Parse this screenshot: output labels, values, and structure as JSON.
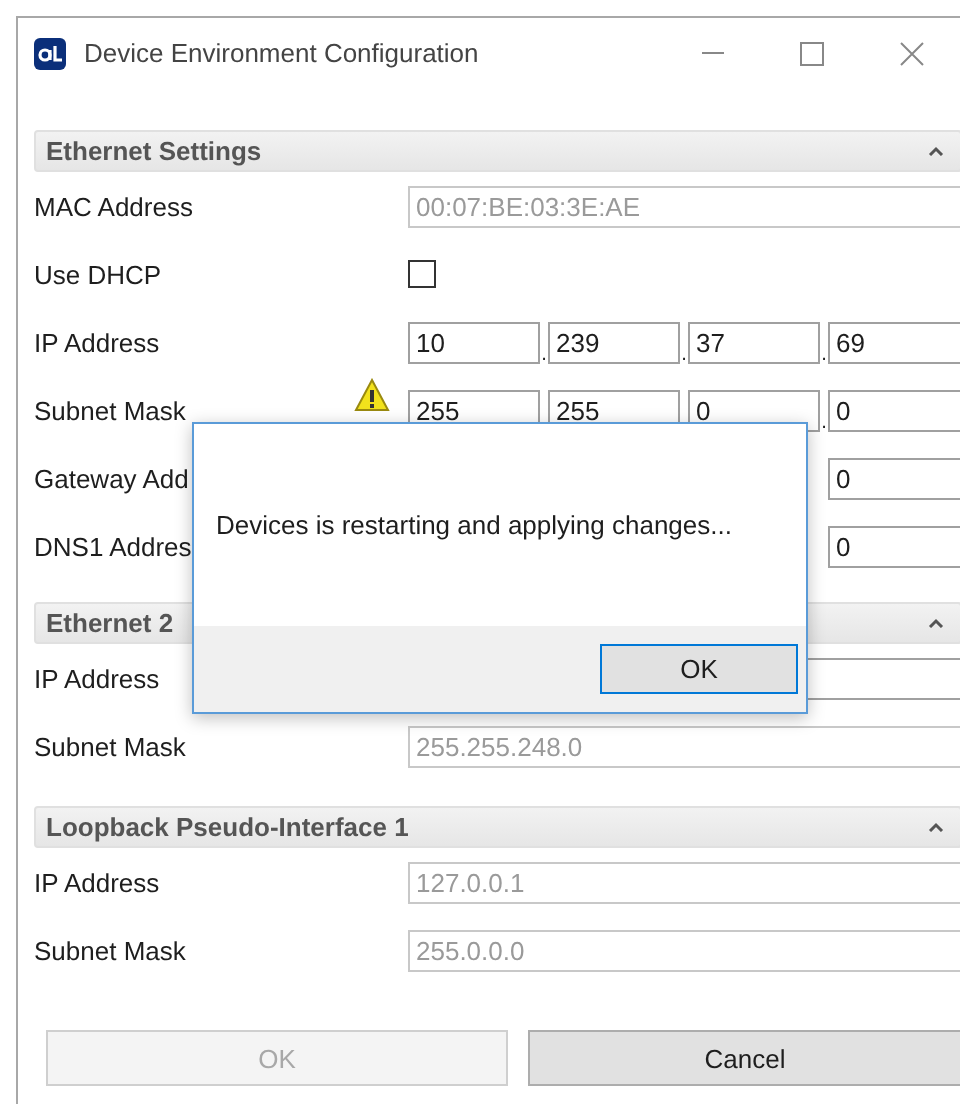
{
  "window": {
    "title": "Device Environment Configuration"
  },
  "octet_separator": ".",
  "sections": [
    {
      "title": "Ethernet Settings",
      "expanded": true,
      "rows": [
        {
          "kind": "text",
          "label": "MAC Address",
          "value": "00:07:BE:03:3E:AE",
          "disabled": true
        },
        {
          "kind": "checkbox",
          "label": "Use DHCP",
          "checked": false
        },
        {
          "kind": "ip",
          "label": "IP Address",
          "octets": [
            "10",
            "239",
            "37",
            "69"
          ]
        },
        {
          "kind": "ip",
          "label": "Subnet Mask",
          "octets": [
            "255",
            "255",
            "0",
            "0"
          ],
          "warning": true
        },
        {
          "kind": "ip",
          "label": "Gateway Add",
          "octets": [
            "0"
          ]
        },
        {
          "kind": "ip",
          "label": "DNS1 Addres",
          "octets": [
            "0"
          ]
        }
      ]
    },
    {
      "title": "Ethernet 2",
      "expanded": true,
      "rows": [
        {
          "kind": "text",
          "label": "IP Address",
          "disabled": false
        },
        {
          "kind": "text",
          "label": "Subnet Mask",
          "value": "255.255.248.0",
          "disabled": true
        }
      ]
    },
    {
      "title": "Loopback Pseudo-Interface 1",
      "expanded": true,
      "rows": [
        {
          "kind": "text",
          "label": "IP Address",
          "value": "127.0.0.1",
          "disabled": true
        },
        {
          "kind": "text",
          "label": "Subnet Mask",
          "value": "255.0.0.0",
          "disabled": true
        }
      ]
    }
  ],
  "buttons": [
    {
      "label": "OK",
      "disabled": true
    },
    {
      "label": "Cancel",
      "disabled": false
    }
  ],
  "dialog": {
    "message": "Devices is restarting and applying changes...",
    "button": "OK"
  }
}
